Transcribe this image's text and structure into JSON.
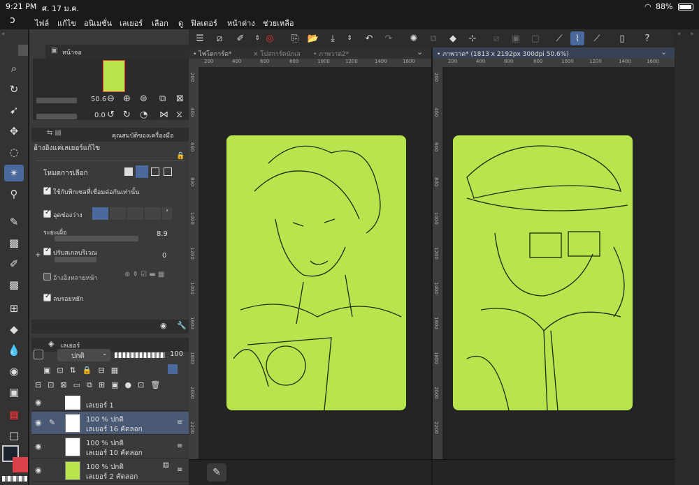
{
  "status": {
    "time": "9:21 PM",
    "date": "ศ. 17 ม.ค.",
    "battery": "88%"
  },
  "menu": [
    "ไฟล์",
    "แก้ไข",
    "อนิเมชั่น",
    "เลเยอร์",
    "เลือก",
    "ดู",
    "ฟิลเตอร์",
    "หน้าต่าง",
    "ช่วยเหลือ"
  ],
  "navigator": {
    "tab": "หน้าจอ",
    "zoom": "50.6",
    "rotate": "0.0"
  },
  "tool_property": {
    "tab": "คุณสมบัติของเครื่องมือ",
    "header": "อ้างอิงแค่เลเยอร์แก้ไข",
    "selection_mode": "โหมดการเลือก",
    "opt_adjacent": "ใช้กับพิกเซลที่เชื่อมต่อกันเท่านั้น",
    "opt_gap": "อุดช่องว่าง",
    "tolerance_label": "ระยะเผื่อ",
    "tolerance": "8.9",
    "expand_label": "ปรับสเกลบริเวณ",
    "expand": "0",
    "multi_ref": "อ้างอิงหลายหน้า",
    "antialias": "ลบรอยหยัก"
  },
  "layers": {
    "tab": "เลเยอร์",
    "blend": "ปกติ",
    "opacity": "100",
    "items": [
      {
        "name": "เลเยอร์ 1",
        "mode": "",
        "selected": false
      },
      {
        "name": "เลเยอร์ 16 คัดลอก",
        "mode": "100 % ปกติ",
        "selected": true
      },
      {
        "name": "เลเยอร์ 10 คัดลอก",
        "mode": "100 % ปกติ",
        "selected": false
      },
      {
        "name": "เลเยอร์ 2 คัดลอก",
        "mode": "100 % ปกติ",
        "selected": false
      }
    ]
  },
  "tabs_left": [
    "ไฟโตการ์ด*",
    "โปสการ์ดนักเล",
    "ภาพวาด2*"
  ],
  "tab_right": "ภาพวาด* (1813 x 2192px 300dpi 50.6%)",
  "ruler_h_left": [
    "200",
    "400",
    "600",
    "800",
    "1000",
    "1200",
    "1400",
    "1600"
  ],
  "ruler_h_right": [
    "200",
    "400",
    "600",
    "800",
    "1000",
    "1200",
    "1400",
    "1600"
  ],
  "ruler_v": [
    "200",
    "400",
    "600",
    "800",
    "1000",
    "1200",
    "1400",
    "1600",
    "1800",
    "2000",
    "2200"
  ],
  "colors": {
    "canvas": "#b8e44d",
    "fg": "#1b2230",
    "bg": "#d9424a",
    "accent": "#4a6a9e"
  }
}
